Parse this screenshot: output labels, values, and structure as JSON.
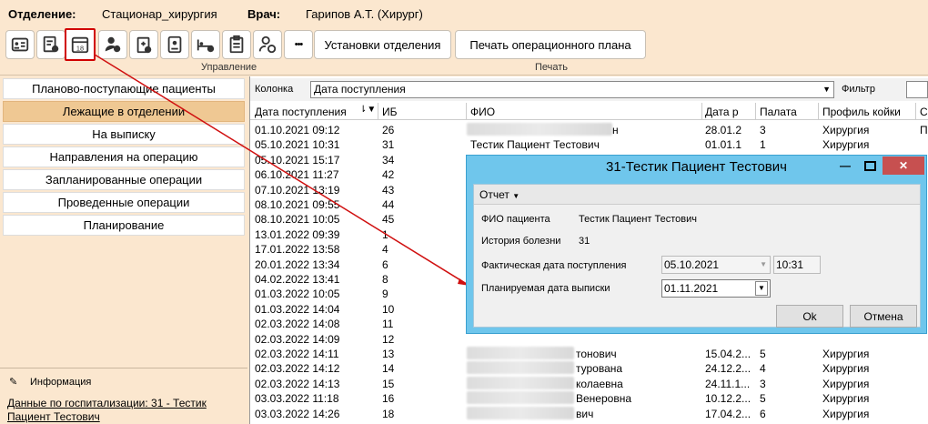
{
  "header": {
    "dept_label": "Отделение:",
    "dept_value": "Стационар_хирургия",
    "doctor_label": "Врач:",
    "doctor_value": "Гарипов А.Т. (Хирург)"
  },
  "toolbar": {
    "calendar_day": "18",
    "more": "•••",
    "settings_btn": "Установки отделения",
    "print_btn": "Печать операционного плана",
    "group_manage": "Управление",
    "group_print": "Печать"
  },
  "sidebar": {
    "items": [
      "Планово-поступающие пациенты",
      "Лежащие в отделении",
      "На выписку",
      "Направления на операцию",
      "Запланированные операции",
      "Проведенные операции",
      "Планирование"
    ],
    "info_title": "Информация",
    "info_link": "Данные по госпитализации: 31 - Тестик Пациент Тестович"
  },
  "filter": {
    "column_label": "Колонка",
    "column_value": "Дата поступления",
    "filter_label": "Фильтр"
  },
  "table": {
    "headers": [
      "Дата поступления",
      "ИБ",
      "ФИО",
      "Дата р",
      "Палата",
      "Профиль койки",
      "С"
    ],
    "rows": [
      [
        "01.10.2021 09:12",
        "26",
        "...н",
        "28.01.2",
        "3",
        "Хирургия",
        "П"
      ],
      [
        "05.10.2021 10:31",
        "31",
        "Тестик Пациент Тестович",
        "01.01.1",
        "1",
        "Хирургия",
        ""
      ],
      [
        "05.10.2021 15:17",
        "34",
        "",
        "",
        "",
        "",
        ""
      ],
      [
        "06.10.2021 11:27",
        "42",
        "",
        "",
        "",
        "",
        ""
      ],
      [
        "07.10.2021 13:19",
        "43",
        "",
        "",
        "",
        "",
        ""
      ],
      [
        "08.10.2021 09:55",
        "44",
        "",
        "",
        "",
        "",
        ""
      ],
      [
        "08.10.2021 10:05",
        "45",
        "",
        "",
        "",
        "",
        ""
      ],
      [
        "13.01.2022 09:39",
        "1",
        "",
        "",
        "",
        "",
        ""
      ],
      [
        "17.01.2022 13:58",
        "4",
        "",
        "",
        "",
        "",
        ""
      ],
      [
        "20.01.2022 13:34",
        "6",
        "",
        "",
        "",
        "",
        ""
      ],
      [
        "04.02.2022 13:41",
        "8",
        "",
        "",
        "",
        "",
        ""
      ],
      [
        "01.03.2022 10:05",
        "9",
        "",
        "",
        "",
        "",
        ""
      ],
      [
        "01.03.2022 14:04",
        "10",
        "",
        "",
        "",
        "",
        ""
      ],
      [
        "02.03.2022 14:08",
        "11",
        "",
        "",
        "",
        "",
        ""
      ],
      [
        "02.03.2022 14:09",
        "12",
        "",
        "",
        "",
        "",
        ""
      ],
      [
        "02.03.2022 14:11",
        "13",
        "...тонович",
        "15.04.2...",
        "5",
        "Хирургия",
        ""
      ],
      [
        "02.03.2022 14:12",
        "14",
        "...турована",
        "24.12.2...",
        "4",
        "Хирургия",
        ""
      ],
      [
        "02.03.2022 14:13",
        "15",
        "...колаевна",
        "24.11.1...",
        "3",
        "Хирургия",
        ""
      ],
      [
        "03.03.2022 11:18",
        "16",
        "... Венеровна",
        "10.12.2...",
        "5",
        "Хирургия",
        ""
      ],
      [
        "03.03.2022 14:26",
        "18",
        "...вич",
        "17.04.2...",
        "6",
        "Хирургия",
        ""
      ]
    ]
  },
  "dialog": {
    "title": "31-Тестик Пациент Тестович",
    "menu": "Отчет",
    "fio_label": "ФИО пациента",
    "fio_value": "Тестик Пациент Тестович",
    "ib_label": "История болезни",
    "ib_value": "31",
    "fact_label": "Фактическая дата поступления",
    "fact_date": "05.10.2021",
    "fact_time": "10:31",
    "plan_label": "Планируемая дата выписки",
    "plan_date": "01.11.2021",
    "ok": "Ok",
    "cancel": "Отмена"
  }
}
